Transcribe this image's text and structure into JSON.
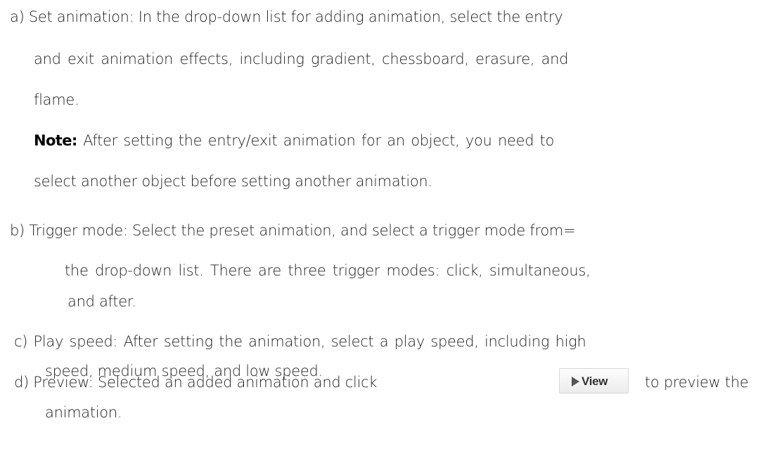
{
  "items": {
    "a": {
      "line1": "a) Set animation: In the drop-down list for adding animation, select the entry",
      "line2": "and exit animation effects, including gradient, chessboard, erasure, and",
      "line3": "flame.",
      "note_label": "Note:",
      "note_line1": " After setting the entry/exit animation for an object, you need to",
      "note_line2": "select another object before setting another animation."
    },
    "b": {
      "line1": "b) Trigger mode: Select the preset animation, and select a trigger mode from=",
      "line2": "the drop-down list. There are three trigger modes: click, simultaneous,",
      "line3": "and after."
    },
    "c": {
      "line1": "c) Play speed: After setting the animation, select a play speed, including high",
      "line2": "speed, medium speed, and low speed."
    },
    "d": {
      "line1_before": "d) Preview: Selected an added animation and click",
      "button_label": "View",
      "button_icon": "play-triangle-icon",
      "line1_after": "to preview the",
      "line2": "animation."
    }
  }
}
